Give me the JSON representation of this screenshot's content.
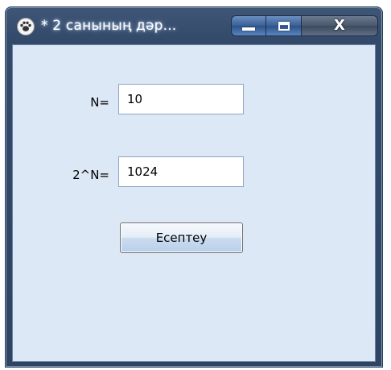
{
  "window": {
    "title": "* 2 санының дәр...",
    "icon": "paw-icon"
  },
  "caption_buttons": {
    "minimize_icon": "minimize-icon",
    "maximize_icon": "maximize-icon",
    "close_label": "X"
  },
  "form": {
    "n_label": "N=",
    "n_value": "10",
    "pow_label": "2^N=",
    "pow_value": "1024",
    "calc_button_label": "Есептеу"
  },
  "colors": {
    "client_background": "#dde8f6",
    "titlebar": "#344a6a"
  }
}
